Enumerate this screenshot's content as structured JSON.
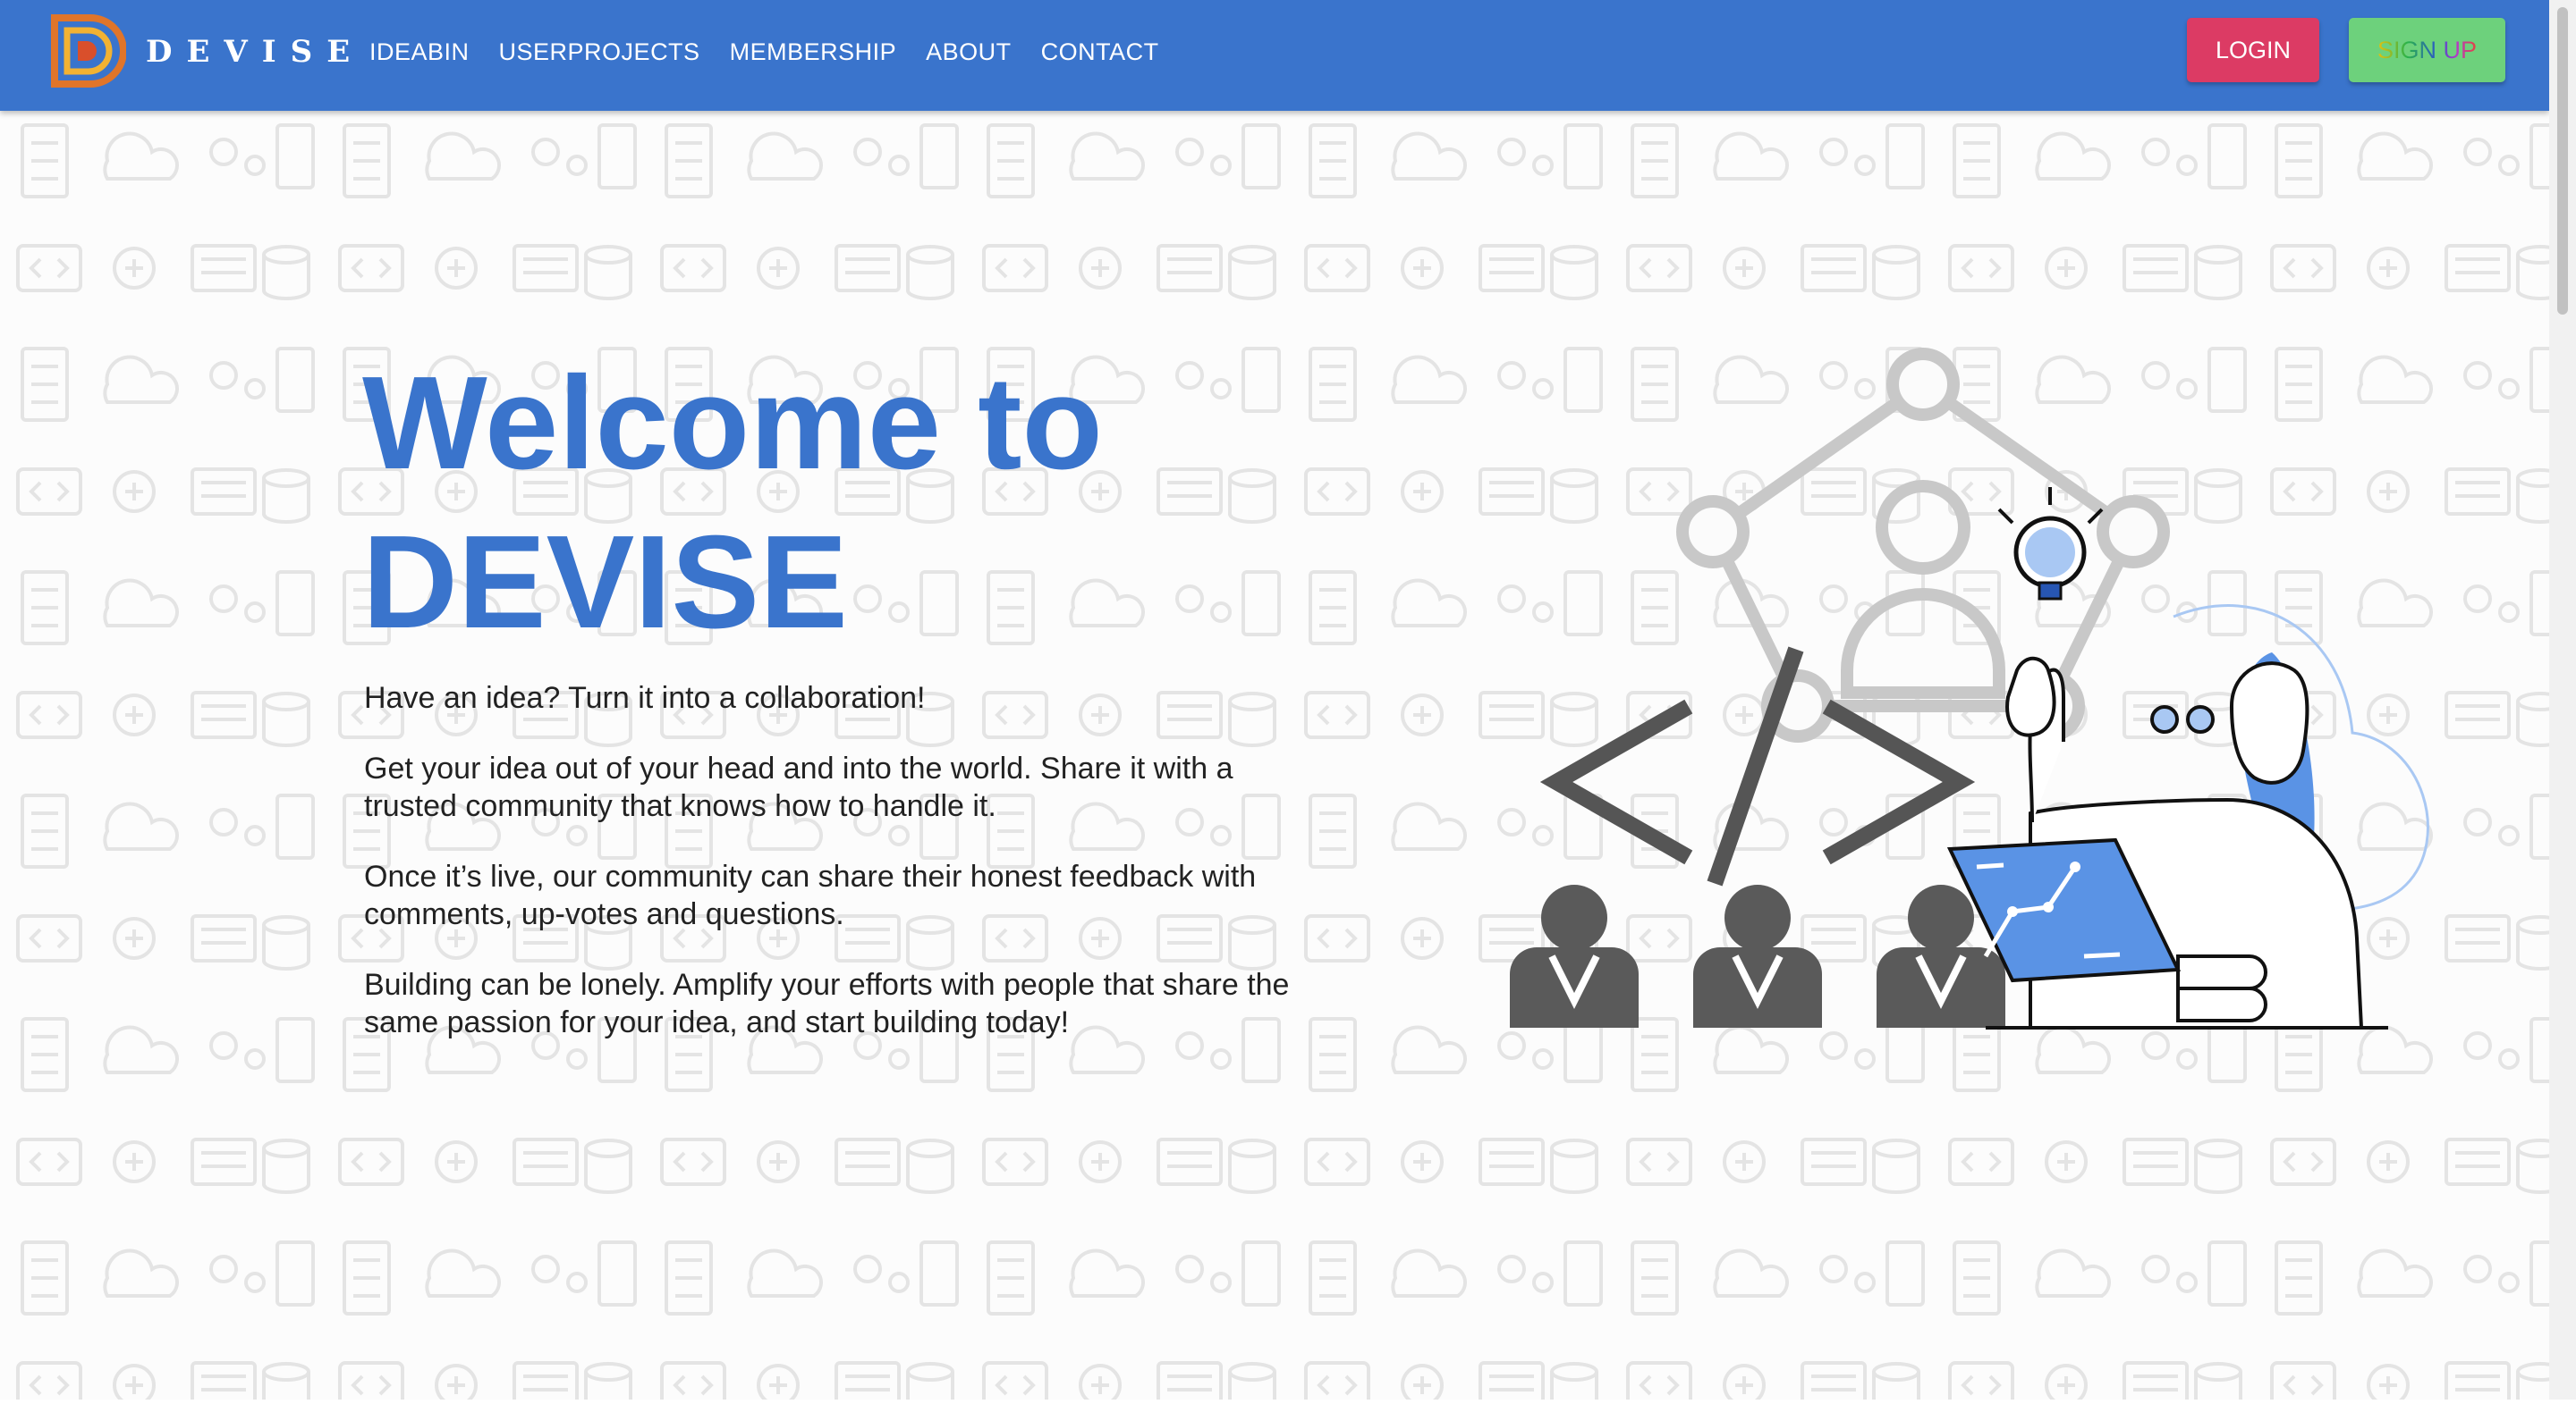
{
  "brand": {
    "name": "DEVISE"
  },
  "nav": {
    "links": [
      "IDEABIN",
      "USERPROJECTS",
      "MEMBERSHIP",
      "ABOUT",
      "CONTACT"
    ],
    "login_label": "LOGIN",
    "signup_label": "SIGN UP"
  },
  "hero": {
    "title_line1": "Welcome to",
    "title_line2": "DEVISE",
    "paragraphs": [
      "Have an idea? Turn it into a collaboration!",
      "Get your idea out of your head and into the world. Share it with a trusted community that knows how to handle it.",
      "Once it’s live, our community can share their honest feedback with comments, up-votes and questions.",
      "Building can be lonely. Amplify your efforts with people that share the same passion for your idea, and start building today!"
    ]
  },
  "colors": {
    "navbar": "#3a74cc",
    "title": "#3a74cc",
    "login": "#dc3b64",
    "signup": "#6dd17c"
  },
  "icons": [
    "devise-logo-icon",
    "code-brackets-icon",
    "person-icon",
    "lightbulb-icon",
    "laptop-icon",
    "network-icon"
  ]
}
